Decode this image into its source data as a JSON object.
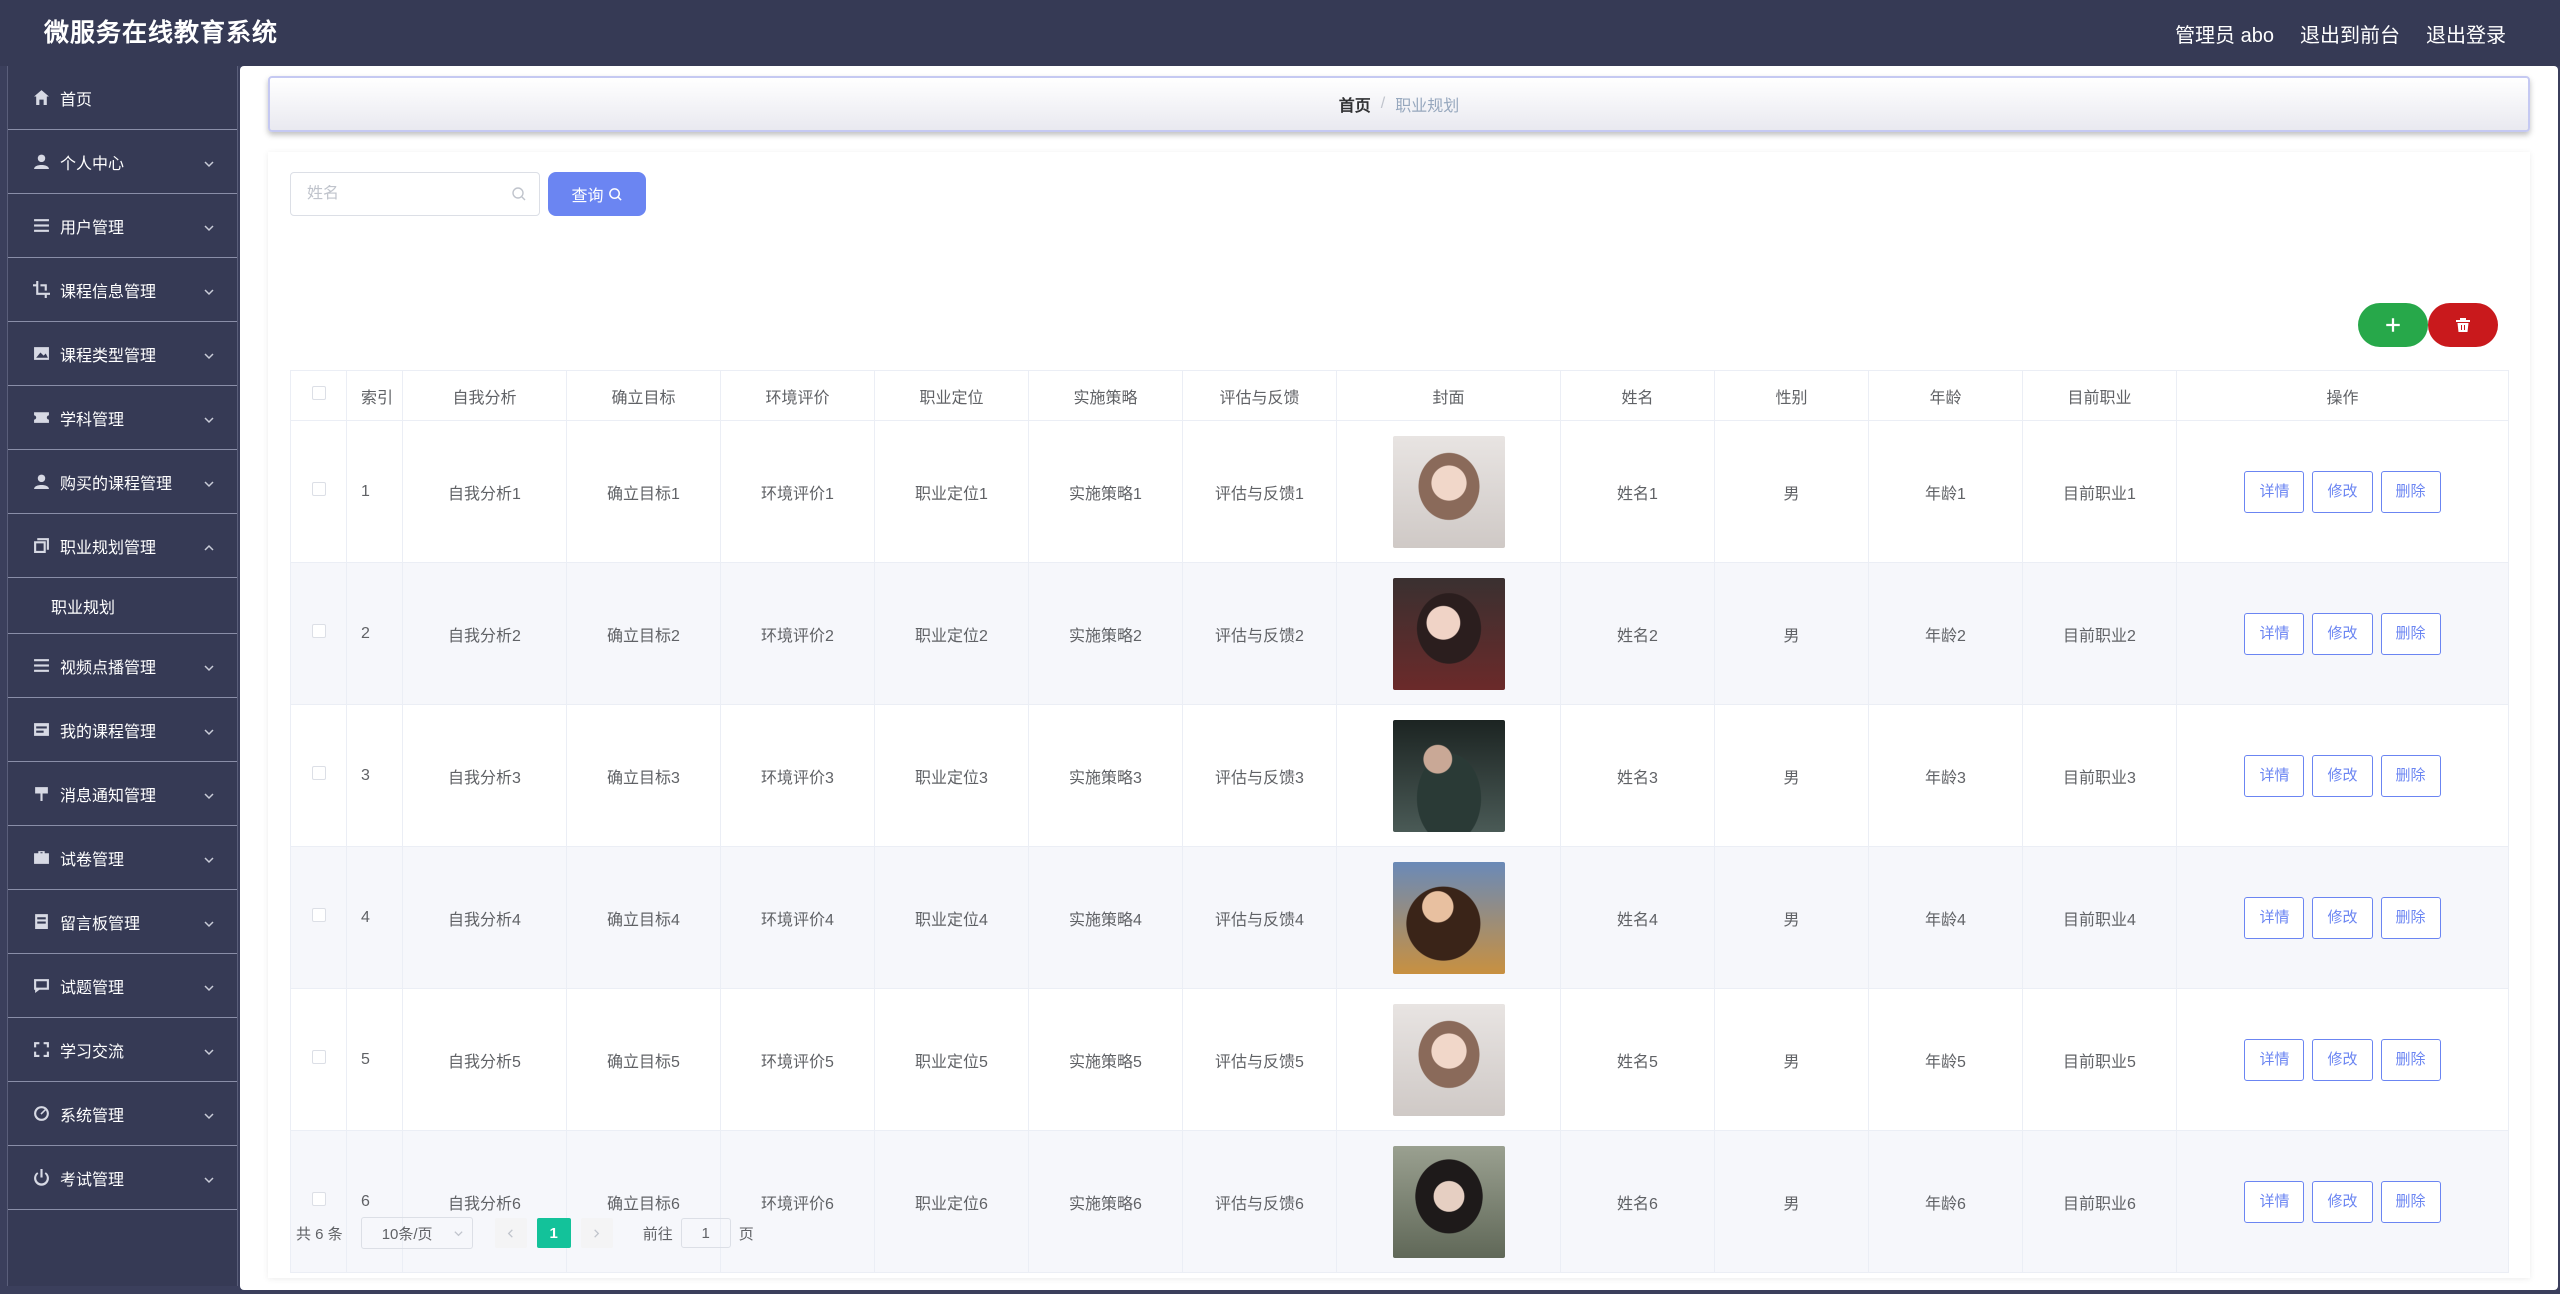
{
  "header": {
    "app_title": "微服务在线教育系统",
    "admin_label": "管理员 abo",
    "exit_frontend": "退出到前台",
    "logout": "退出登录"
  },
  "sidebar": {
    "items": [
      {
        "label": "首页",
        "icon": "home-icon"
      },
      {
        "label": "个人中心",
        "icon": "user-icon"
      },
      {
        "label": "用户管理",
        "icon": "list-icon"
      },
      {
        "label": "课程信息管理",
        "icon": "crop-icon"
      },
      {
        "label": "课程类型管理",
        "icon": "picture-icon"
      },
      {
        "label": "学科管理",
        "icon": "ticket-icon"
      },
      {
        "label": "购买的课程管理",
        "icon": "user-icon"
      },
      {
        "label": "职业规划管理",
        "icon": "copy-icon"
      },
      {
        "label": "视频点播管理",
        "icon": "list-icon"
      },
      {
        "label": "我的课程管理",
        "icon": "tickets-icon"
      },
      {
        "label": "消息通知管理",
        "icon": "flag-icon"
      },
      {
        "label": "试卷管理",
        "icon": "suitcase-icon"
      },
      {
        "label": "留言板管理",
        "icon": "notebook-icon"
      },
      {
        "label": "试题管理",
        "icon": "chat-icon"
      },
      {
        "label": "学习交流",
        "icon": "fullscreen-icon"
      },
      {
        "label": "系统管理",
        "icon": "odometer-icon"
      },
      {
        "label": "考试管理",
        "icon": "power-icon"
      }
    ],
    "submenu_label": "职业规划"
  },
  "breadcrumb": {
    "home": "首页",
    "separator": "/",
    "current": "职业规划"
  },
  "search": {
    "placeholder": "姓名",
    "button_label": "查询"
  },
  "table": {
    "headers": [
      "索引",
      "自我分析",
      "确立目标",
      "环境评价",
      "职业定位",
      "实施策略",
      "评估与反馈",
      "封面",
      "姓名",
      "性别",
      "年龄",
      "目前职业",
      "操作"
    ],
    "rows": [
      {
        "index": "1",
        "self_analysis": "自我分析1",
        "goal": "确立目标1",
        "env": "环境评价1",
        "position": "职业定位1",
        "strategy": "实施策略1",
        "feedback": "评估与反馈1",
        "name": "姓名1",
        "gender": "男",
        "age": "年龄1",
        "job": "目前职业1"
      },
      {
        "index": "2",
        "self_analysis": "自我分析2",
        "goal": "确立目标2",
        "env": "环境评价2",
        "position": "职业定位2",
        "strategy": "实施策略2",
        "feedback": "评估与反馈2",
        "name": "姓名2",
        "gender": "男",
        "age": "年龄2",
        "job": "目前职业2"
      },
      {
        "index": "3",
        "self_analysis": "自我分析3",
        "goal": "确立目标3",
        "env": "环境评价3",
        "position": "职业定位3",
        "strategy": "实施策略3",
        "feedback": "评估与反馈3",
        "name": "姓名3",
        "gender": "男",
        "age": "年龄3",
        "job": "目前职业3"
      },
      {
        "index": "4",
        "self_analysis": "自我分析4",
        "goal": "确立目标4",
        "env": "环境评价4",
        "position": "职业定位4",
        "strategy": "实施策略4",
        "feedback": "评估与反馈4",
        "name": "姓名4",
        "gender": "男",
        "age": "年龄4",
        "job": "目前职业4"
      },
      {
        "index": "5",
        "self_analysis": "自我分析5",
        "goal": "确立目标5",
        "env": "环境评价5",
        "position": "职业定位5",
        "strategy": "实施策略5",
        "feedback": "评估与反馈5",
        "name": "姓名5",
        "gender": "男",
        "age": "年龄5",
        "job": "目前职业5"
      },
      {
        "index": "6",
        "self_analysis": "自我分析6",
        "goal": "确立目标6",
        "env": "环境评价6",
        "position": "职业定位6",
        "strategy": "实施策略6",
        "feedback": "评估与反馈6",
        "name": "姓名6",
        "gender": "男",
        "age": "年龄6",
        "job": "目前职业6"
      }
    ],
    "actions": {
      "detail": "详情",
      "edit": "修改",
      "delete": "删除"
    }
  },
  "pagination": {
    "total": "共 6 条",
    "page_size": "10条/页",
    "current_page": "1",
    "goto_prefix": "前往",
    "goto_value": "1",
    "goto_suffix": "页"
  },
  "colors": {
    "header_bg": "#363a55",
    "primary": "#6b85f2",
    "add": "#27a84a",
    "delete": "#c9191c",
    "page_active": "#13c29a"
  }
}
